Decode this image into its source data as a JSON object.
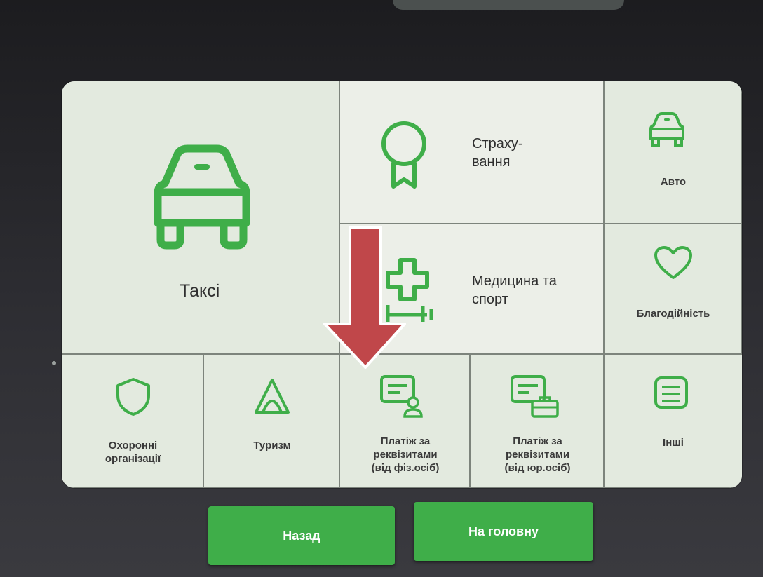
{
  "colors": {
    "accent": "#3fae49",
    "tile": "#e3eadf",
    "arrow": "#c0474a"
  },
  "tiles": {
    "taxi": {
      "label": "Таксі",
      "icon": "car-icon"
    },
    "insurance": {
      "line1": "Страху-",
      "line2": "вання",
      "icon": "medal-icon"
    },
    "auto": {
      "label": "Авто",
      "icon": "car-icon"
    },
    "medicine": {
      "line1": "Медицина та",
      "line2": "спорт",
      "icon": "medical-cross-dumbbell-icon"
    },
    "charity": {
      "label": "Благодійність",
      "icon": "heart-icon"
    },
    "security": {
      "line1": "Охоронні",
      "line2": "організації",
      "icon": "shield-icon"
    },
    "tourism": {
      "label": "Туризм",
      "icon": "tent-icon"
    },
    "pay_individuals": {
      "line1": "Платіж за",
      "line2": "реквізитами",
      "line3": "(від фіз.осіб)",
      "icon": "card-person-icon"
    },
    "pay_legal": {
      "line1": "Платіж за",
      "line2": "реквізитами",
      "line3": "(від юр.осіб)",
      "icon": "card-briefcase-icon"
    },
    "other": {
      "label": "Інші",
      "icon": "list-icon"
    }
  },
  "buttons": {
    "back": "Назад",
    "home": "На головну"
  }
}
